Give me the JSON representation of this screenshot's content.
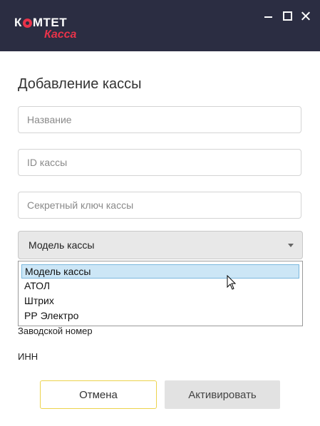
{
  "app": {
    "logo_top": "КОМТЕТ",
    "logo_bottom": "Касса"
  },
  "window_controls": [
    "minimize",
    "maximize",
    "close"
  ],
  "form": {
    "title": "Добавление кассы",
    "name_placeholder": "Название",
    "id_placeholder": "ID кассы",
    "secret_placeholder": "Секретный ключ кассы",
    "model_selected": "Модель кассы",
    "model_options": [
      "Модель кассы",
      "АТОЛ",
      "Штрих",
      "РР Электро"
    ],
    "serial_label": "Заводской номер",
    "inn_label": "ИНН"
  },
  "buttons": {
    "cancel": "Отмена",
    "activate": "Активировать"
  },
  "colors": {
    "titlebar": "#2b2d42",
    "brand_red": "#e8334a",
    "cancel_border": "#ecd34c",
    "option_highlight": "#cce6f6"
  }
}
